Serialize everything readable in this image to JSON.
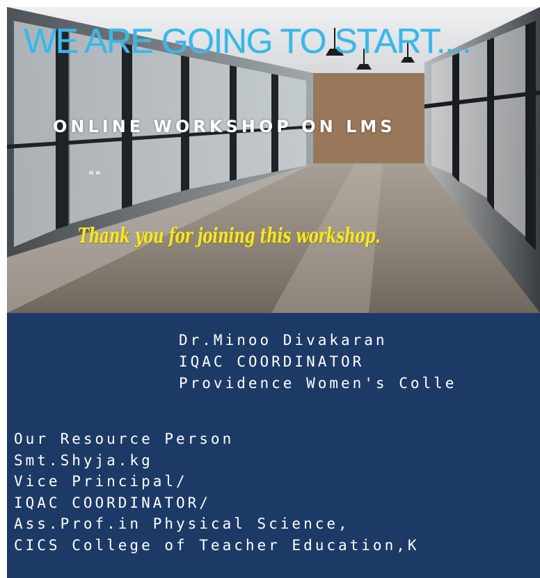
{
  "poster": {
    "headline": "WE ARE GOING TO START....",
    "subtitle": "ONLINE WORKSHOP ON LMS",
    "thanks": "Thank you for joining this workshop.",
    "colors": {
      "headline": "#3ab7ea",
      "thanks": "#f6e62a",
      "band": "#1d3a66"
    }
  },
  "coordinator": {
    "lines": [
      "Dr.Minoo Divakaran",
      "IQAC COORDINATOR",
      "Providence Women's Colle"
    ]
  },
  "resource_person": {
    "lines": [
      "Our Resource Person",
      "Smt.Shyja.kg",
      "Vice Principal/",
      "IQAC COORDINATOR/",
      "Ass.Prof.in Physical Science,",
      "CICS College of Teacher Education,K"
    ]
  }
}
